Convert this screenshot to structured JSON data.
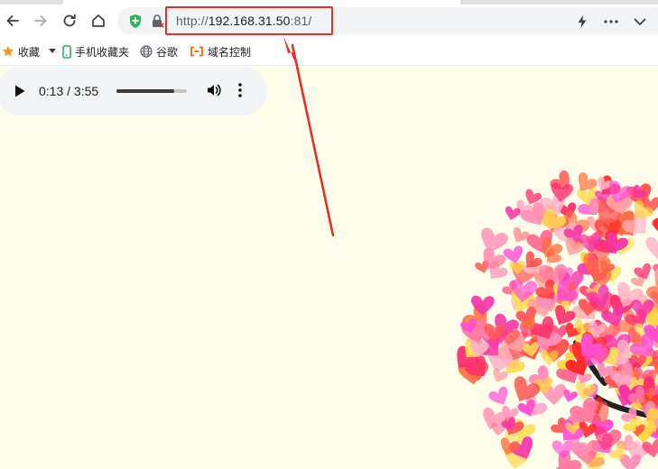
{
  "browser": {
    "address": {
      "scheme": "http://",
      "host": "192.168.31.50",
      "suffix": ":81/"
    },
    "icons": [
      "back-icon",
      "forward-icon",
      "reload-icon",
      "home-icon",
      "shield-icon",
      "lock-icon",
      "lightning-icon",
      "more-icon",
      "chevron-down-icon"
    ]
  },
  "bookmarks": [
    {
      "label": "收藏",
      "icon": "star-icon"
    },
    {
      "label": "手机收藏夹",
      "icon": "phone-icon"
    },
    {
      "label": "谷歌",
      "icon": "globe-icon"
    },
    {
      "label": "域名控制",
      "icon": "domain-icon"
    }
  ],
  "audio": {
    "time": "0:13 / 3:55",
    "progress": 0.82
  },
  "colors": {
    "page_background": "#fffeeb",
    "annotation": "#e3302a",
    "toolbar": "#ffffff",
    "omnibox": "#f1f3f4"
  }
}
